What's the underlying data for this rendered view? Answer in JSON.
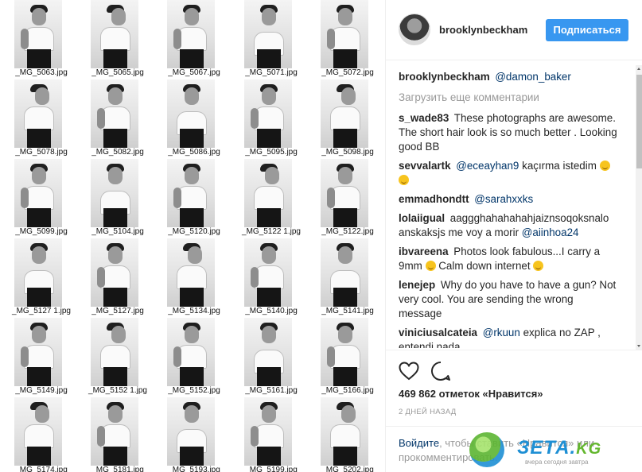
{
  "grid": {
    "rows": [
      [
        "_MG_5063.jpg",
        "_MG_5065.jpg",
        "_MG_5067.jpg",
        "_MG_5071.jpg",
        "_MG_5072.jpg"
      ],
      [
        "_MG_5078.jpg",
        "_MG_5082.jpg",
        "_MG_5086.jpg",
        "_MG_5095.jpg",
        "_MG_5098.jpg"
      ],
      [
        "_MG_5099.jpg",
        "_MG_5104.jpg",
        "_MG_5120.jpg",
        "_MG_5122 1.jpg",
        "_MG_5122.jpg"
      ],
      [
        "_MG_5127 1.jpg",
        "_MG_5127.jpg",
        "_MG_5134.jpg",
        "_MG_5140.jpg",
        "_MG_5141.jpg"
      ],
      [
        "_MG_5149.jpg",
        "_MG_5152 1.jpg",
        "_MG_5152.jpg",
        "_MG_5161.jpg",
        "_MG_5166.jpg"
      ],
      [
        "_MG_5174.jpg",
        "_MG_5181.jpg",
        "_MG_5193.jpg",
        "_MG_5199.jpg",
        "_MG_5202.jpg"
      ]
    ]
  },
  "header": {
    "username": "brooklynbeckham",
    "follow_label": "Подписаться"
  },
  "caption": {
    "user": "brooklynbeckham",
    "mention": "@damon_baker"
  },
  "load_more": "Загрузить еще комментарии",
  "comments": [
    {
      "user": "s_wade83",
      "text": "These photographs are awesome. The short hair look is so much better . Looking good BB"
    },
    {
      "user": "sevvalartk",
      "mention": "@eceayhan9",
      "text": "kaçırma istedim"
    },
    {
      "user": "emmadhondtt",
      "mention": "@sarahxxks"
    },
    {
      "user": "lolaiigual",
      "text": "aaggghahahahahjaiznsoqoksnalo anskaksjs me voy a morir",
      "mention_after": "@aiinhoa24"
    },
    {
      "user": "ibvareena",
      "text": "Photos look fabulous...I carry a 9mm",
      "text_after": "Calm down internet"
    },
    {
      "user": "lenejep",
      "text": "Why do you have to have a gun? Not very cool. You are sending the wrong message"
    },
    {
      "user": "viniciusalcateia",
      "mention": "@rkuun",
      "text": "explica no ZAP , entendi nada"
    }
  ],
  "actions": {
    "likes": "469 862 отметок «Нравится»",
    "timestamp": "2 ДНЕЙ НАЗАД"
  },
  "login_prompt": {
    "link": "Войдите",
    "rest": ", чтобы ставить «Нравится» или прокомментировать."
  },
  "watermark": {
    "brand": "ЗЕТА.",
    "tld": "KG",
    "tagline": "вчера сегодня завтра"
  },
  "colors": {
    "follow_button": "#3897f0",
    "mention": "#003569",
    "secondary_text": "#999999"
  },
  "icons": [
    "heart-icon",
    "comment-icon",
    "smile-emoji-icon"
  ]
}
